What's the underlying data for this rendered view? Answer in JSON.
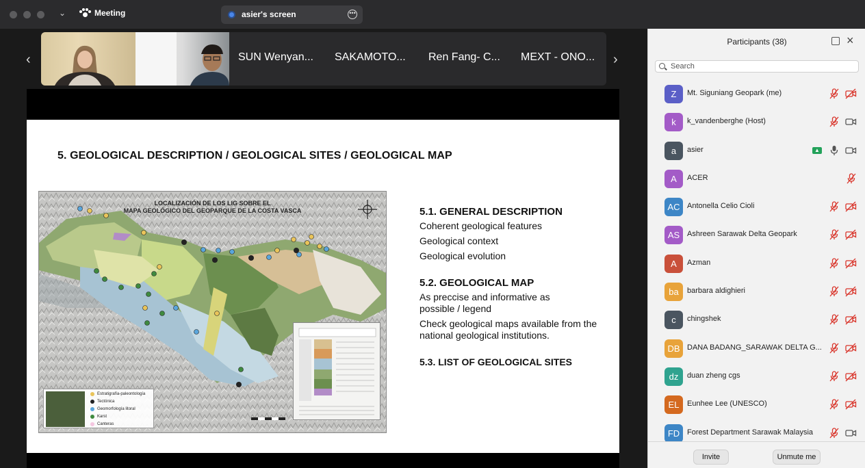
{
  "window": {
    "title": "Meeting"
  },
  "share": {
    "label": "asier's screen"
  },
  "video_strip": {
    "tiles": [
      "SUN Wenyan...",
      "SAKAMOTO...",
      "Ren Fang- C...",
      "MEXT - ONO..."
    ]
  },
  "slide": {
    "title": "5. GEOLOGICAL DESCRIPTION / GEOLOGICAL SITES / GEOLOGICAL MAP",
    "map_title_line1": "LOCALIZACIÓN DE LOS LIG SOBRE EL",
    "map_title_line2": "MAPA GEOLÓGICO DEL GEOPARQUE DE LA COSTA VASCA",
    "legend": [
      "Estratigrafía-paleontología",
      "Tectónica",
      "Geomorfología litoral",
      "Karst",
      "Canteras"
    ],
    "legend_colors": [
      "#e9c45a",
      "#222222",
      "#5aa6dc",
      "#3f8a3f",
      "#f4c6e0"
    ],
    "sections": [
      {
        "heading": "5.1. GENERAL DESCRIPTION",
        "lines": [
          "Coherent geological features",
          "Geological context",
          "Geological evolution"
        ]
      },
      {
        "heading": "5.2. GEOLOGICAL MAP",
        "lines": [
          "As preccise and informative as possible / legend",
          "Check geological maps available from the national geological institutions."
        ]
      },
      {
        "heading": "5.3. LIST OF GEOLOGICAL SITES",
        "lines": []
      }
    ]
  },
  "participants": {
    "title": "Participants (38)",
    "search_placeholder": "Search",
    "list": [
      {
        "initials": "Z",
        "name": "Mt. Siguniang Geopark (me)",
        "color": "#5b5fc7",
        "mic": "muted",
        "cam": "off"
      },
      {
        "initials": "k",
        "name": "k_vandenberghe (Host)",
        "color": "#a35bc7",
        "mic": "muted",
        "cam": "on"
      },
      {
        "initials": "a",
        "name": "asier",
        "color": "#4a5560",
        "mic": "on",
        "cam": "on",
        "sharing": true
      },
      {
        "initials": "A",
        "name": "ACER",
        "color": "#a35bc7",
        "mic": "muted",
        "cam": "none"
      },
      {
        "initials": "AC",
        "name": "Antonella Celio Cioli",
        "color": "#3d86c6",
        "mic": "muted",
        "cam": "off"
      },
      {
        "initials": "AS",
        "name": "Ashreen Sarawak Delta Geopark",
        "color": "#a35bc7",
        "mic": "muted",
        "cam": "off"
      },
      {
        "initials": "A",
        "name": "Azman",
        "color": "#c9503a",
        "mic": "muted",
        "cam": "off"
      },
      {
        "initials": "ba",
        "name": "barbara aldighieri",
        "color": "#e8a33a",
        "mic": "muted",
        "cam": "off"
      },
      {
        "initials": "c",
        "name": "chingshek",
        "color": "#4a5560",
        "mic": "muted",
        "cam": "off"
      },
      {
        "initials": "DB",
        "name": "DANA BADANG_SARAWAK DELTA G...",
        "color": "#e8a33a",
        "mic": "muted",
        "cam": "off"
      },
      {
        "initials": "dz",
        "name": "duan zheng cgs",
        "color": "#2fa38f",
        "mic": "muted",
        "cam": "off"
      },
      {
        "initials": "EL",
        "name": "Eunhee Lee (UNESCO)",
        "color": "#d4691f",
        "mic": "muted",
        "cam": "off"
      },
      {
        "initials": "FD",
        "name": "Forest Department Sarawak Malaysia",
        "color": "#3d86c6",
        "mic": "muted",
        "cam": "on"
      }
    ],
    "invite_label": "Invite",
    "unmute_label": "Unmute me"
  }
}
